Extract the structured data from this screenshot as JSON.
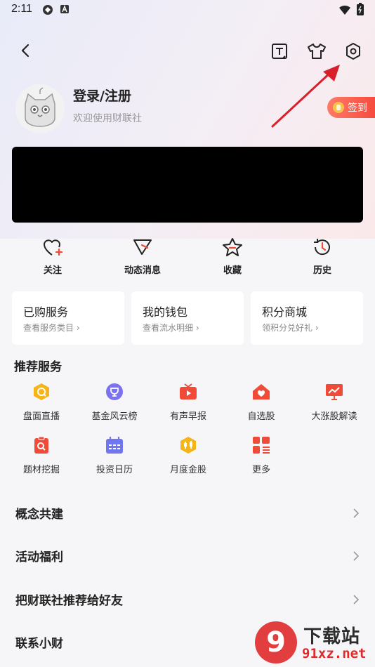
{
  "status_bar": {
    "time": "2:11"
  },
  "profile": {
    "name": "登录/注册",
    "subtitle": "欢迎使用财联社"
  },
  "signin": {
    "label": "签到"
  },
  "shortcuts": [
    {
      "label": "关注",
      "icon": "heart-plus-icon"
    },
    {
      "label": "动态消息",
      "icon": "send-icon"
    },
    {
      "label": "收藏",
      "icon": "star-icon"
    },
    {
      "label": "历史",
      "icon": "history-icon"
    }
  ],
  "cards": [
    {
      "title": "已购服务",
      "sub": "查看服务类目 ›"
    },
    {
      "title": "我的钱包",
      "sub": "查看流水明细 ›"
    },
    {
      "title": "积分商城",
      "sub": "领积分兑好礼 ›"
    }
  ],
  "recommend": {
    "title": "推荐服务",
    "items": [
      {
        "label": "盘面直播",
        "icon": "live-icon",
        "color": "#f5b417"
      },
      {
        "label": "基金风云榜",
        "icon": "trophy-icon",
        "color": "#7b72f0"
      },
      {
        "label": "有声早报",
        "icon": "tv-icon",
        "color": "#f04a38"
      },
      {
        "label": "自选股",
        "icon": "house-heart-icon",
        "color": "#f04a38"
      },
      {
        "label": "大涨股解读",
        "icon": "chart-up-icon",
        "color": "#f04a38"
      },
      {
        "label": "题材挖掘",
        "icon": "clipboard-search-icon",
        "color": "#f04a38"
      },
      {
        "label": "投资日历",
        "icon": "calendar-icon",
        "color": "#6f76f0"
      },
      {
        "label": "月度金股",
        "icon": "gold-stock-icon",
        "color": "#f5b417"
      },
      {
        "label": "更多",
        "icon": "grid-more-icon",
        "color": "#f04a38"
      }
    ]
  },
  "list": [
    {
      "label": "概念共建"
    },
    {
      "label": "活动福利"
    },
    {
      "label": "把财联社推荐给好友"
    },
    {
      "label": "联系小财"
    }
  ],
  "watermark": {
    "text": "下载站",
    "url": "91xz.net",
    "mark": "9"
  },
  "colors": {
    "accent": "#f04a38",
    "arrow": "#d9202a"
  }
}
